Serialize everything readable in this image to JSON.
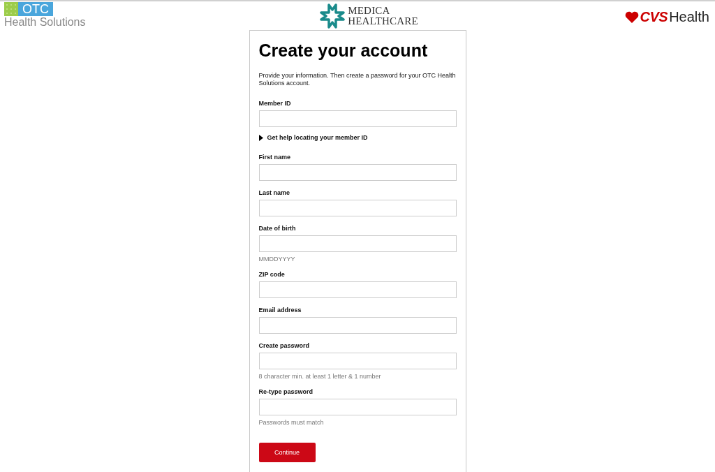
{
  "header": {
    "otc_logo": {
      "badge": "OTC",
      "text": "Health Solutions"
    },
    "medica_logo": {
      "line_1": "MEDICA",
      "line_2": "HEALTHCARE"
    },
    "cvs_logo": {
      "brand": "CVS",
      "text": "Health"
    }
  },
  "form": {
    "title": "Create your account",
    "intro": "Provide your information. Then create a password for your OTC Health Solutions account.",
    "fields": [
      {
        "label": "Member ID",
        "help": {
          "label": "Get help locating your member ID",
          "expanded": false
        }
      },
      {
        "label": "First name"
      },
      {
        "label": "Last name"
      },
      {
        "label": "Date of birth",
        "hint": "MMDDYYYY"
      },
      {
        "label": "ZIP code"
      },
      {
        "label": "Email address"
      },
      {
        "label": "Create password",
        "hint": "8 character min. at least 1 letter & 1 number"
      },
      {
        "label": "Re-type password",
        "hint": "Passwords must match"
      }
    ],
    "button": "Continue"
  }
}
